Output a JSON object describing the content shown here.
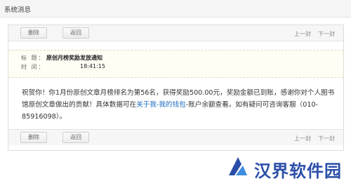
{
  "window": {
    "title": "系统消息"
  },
  "toolbar": {
    "delete_label": "删除",
    "back_label": "返回",
    "prev_label": "上一封",
    "next_label": "下一封"
  },
  "message": {
    "subject_label": "标 题：",
    "subject": "原创月榜奖励发放通知",
    "time_label": "时 间：",
    "time": "18:41:15",
    "body_before_link": "祝贺你！你1月份原创文章月榜排名为第56名，获得奖励500.00元，奖励金额已到账，感谢你对个人图书馆原创文章做出的贡献！具体数据可在",
    "body_link": "关于我-我的钱包",
    "body_after_link": "-账户余额查看。如有疑问可咨询客服（010-85916098）。"
  },
  "watermark": {
    "text": "汉界软件园",
    "color": "#2b4ea8"
  }
}
